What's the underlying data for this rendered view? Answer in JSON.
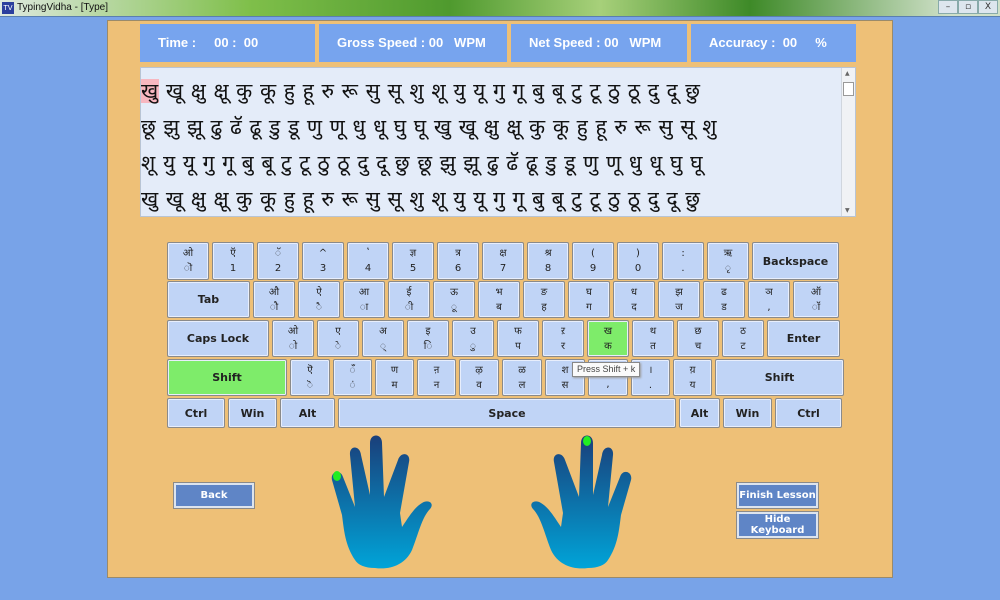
{
  "window": {
    "title": "TypingVidha - [Type]",
    "icon_text": "TV",
    "controls": [
      "–",
      "▫",
      "X"
    ]
  },
  "stats": {
    "time": "Time :     00 :  00",
    "gross_speed": "Gross Speed : 00   WPM",
    "net_speed": "Net Speed : 00   WPM",
    "accuracy": "Accuracy :  00     %"
  },
  "lesson": {
    "current_char": "खु",
    "lines": [
      " खू क्षु क्षू कु कू हु हू रु रू सु सू शु शू यु यू गु गू बु बू टु टू ठु ठू दु दू छु",
      "छू झु झू ढु ढॅ ढू डु डू णु णू धु धू घु घू खु खू क्षु क्षू कु कू हु हू रु रू सु सू शु",
      "शू यु यू गु गू बु बू टु टू ठु ठू दु दू छु छू झु झू ढु ढॅ ढू डु डू णु णू धु धू घु घू",
      "खु खू क्षु क्षू कु कू हु हू रु रू सु सू शु शू यु यू गु गू बु बू टु टू ठु ठू दु दू छु"
    ]
  },
  "keyboard": {
    "highlight_color": "#7eec6a",
    "rows": [
      [
        {
          "top": "ओ",
          "bottom": "ॊ"
        },
        {
          "top": "ऍ",
          "bottom": "1"
        },
        {
          "top": "ॅ",
          "bottom": "2"
        },
        {
          "top": "^",
          "bottom": "3"
        },
        {
          "top": "ʽ",
          "bottom": "4"
        },
        {
          "top": "ज्ञ",
          "bottom": "5"
        },
        {
          "top": "त्र",
          "bottom": "6"
        },
        {
          "top": "क्ष",
          "bottom": "7"
        },
        {
          "top": "श्र",
          "bottom": "8"
        },
        {
          "top": "(",
          "bottom": "9"
        },
        {
          "top": ")",
          "bottom": "0"
        },
        {
          "top": ":",
          "bottom": "."
        },
        {
          "top": "ऋ",
          "bottom": "ृ"
        },
        {
          "label": "Backspace"
        }
      ],
      [
        {
          "label": "Tab"
        },
        {
          "top": "औ",
          "bottom": "ौ"
        },
        {
          "top": "ऐ",
          "bottom": "ै"
        },
        {
          "top": "आ",
          "bottom": "ा"
        },
        {
          "top": "ई",
          "bottom": "ी"
        },
        {
          "top": "ऊ",
          "bottom": "ू"
        },
        {
          "top": "भ",
          "bottom": "ब"
        },
        {
          "top": "ङ",
          "bottom": "ह"
        },
        {
          "top": "घ",
          "bottom": "ग"
        },
        {
          "top": "ध",
          "bottom": "द"
        },
        {
          "top": "झ",
          "bottom": "ज"
        },
        {
          "top": "ढ",
          "bottom": "ड"
        },
        {
          "top": "ञ",
          "bottom": ","
        },
        {
          "top": "ऑ",
          "bottom": "ॉ"
        }
      ],
      [
        {
          "label": "Caps Lock"
        },
        {
          "top": "ओ",
          "bottom": "ो"
        },
        {
          "top": "ए",
          "bottom": "े"
        },
        {
          "top": "अ",
          "bottom": "्"
        },
        {
          "top": "इ",
          "bottom": "ि"
        },
        {
          "top": "उ",
          "bottom": "ु"
        },
        {
          "top": "फ",
          "bottom": "प"
        },
        {
          "top": "ऱ",
          "bottom": "र"
        },
        {
          "top": "ख",
          "bottom": "क",
          "highlight": true
        },
        {
          "top": "थ",
          "bottom": "त"
        },
        {
          "top": "छ",
          "bottom": "च"
        },
        {
          "top": "ठ",
          "bottom": "ट"
        },
        {
          "label": "Enter"
        }
      ],
      [
        {
          "label": "Shift",
          "highlight": true
        },
        {
          "top": "ऎ",
          "bottom": "ॆ"
        },
        {
          "top": "ँ",
          "bottom": "ं"
        },
        {
          "top": "ण",
          "bottom": "म"
        },
        {
          "top": "ऩ",
          "bottom": "न"
        },
        {
          "top": "ऴ",
          "bottom": "व"
        },
        {
          "top": "ळ",
          "bottom": "ल"
        },
        {
          "top": "श",
          "bottom": "स"
        },
        {
          "top": "",
          "bottom": ","
        },
        {
          "top": "।",
          "bottom": "."
        },
        {
          "top": "य़",
          "bottom": "य"
        },
        {
          "label": "Shift"
        }
      ],
      [
        {
          "label": "Ctrl"
        },
        {
          "label": "Win"
        },
        {
          "label": "Alt"
        },
        {
          "label": "Space"
        },
        {
          "label": "Alt"
        },
        {
          "label": "Win"
        },
        {
          "label": "Ctrl"
        }
      ]
    ],
    "tooltip": "Press Shift + k"
  },
  "hands": {
    "left_finger": "pinky",
    "right_finger": "middle",
    "finger_dot_color": "#22ee22",
    "gradient": [
      "#1a3f7a",
      "#00a4d8"
    ]
  },
  "buttons": {
    "back": "Back",
    "finish": "Finish Lesson",
    "hide_keyboard": "Hide Keyboard"
  }
}
